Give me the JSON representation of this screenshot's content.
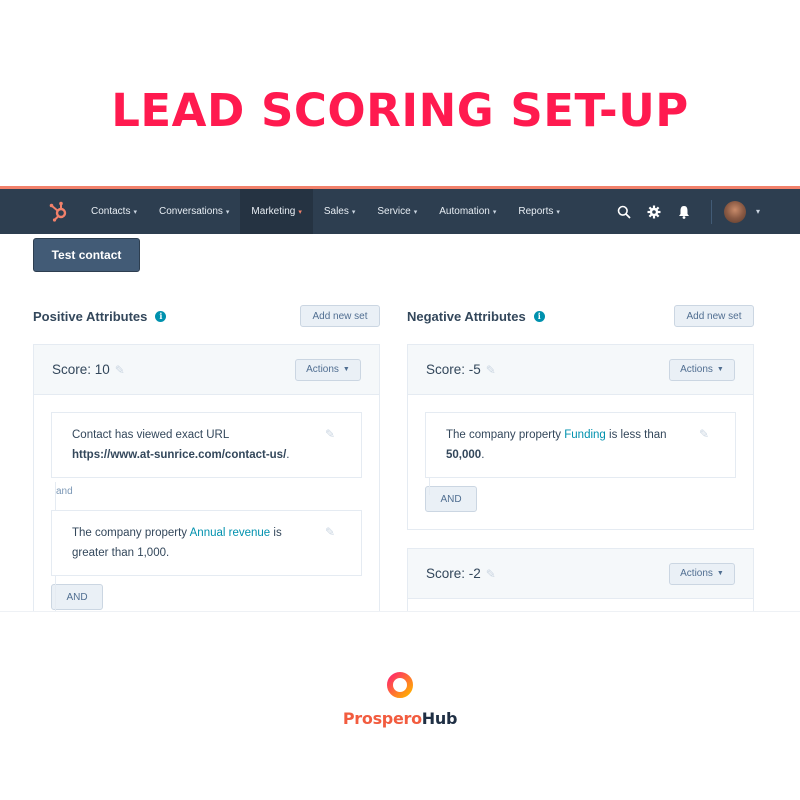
{
  "headline": "LEAD SCORING SET-UP",
  "nav": {
    "items": [
      {
        "label": "Contacts",
        "active": false
      },
      {
        "label": "Conversations",
        "active": false
      },
      {
        "label": "Marketing",
        "active": true
      },
      {
        "label": "Sales",
        "active": false
      },
      {
        "label": "Service",
        "active": false
      },
      {
        "label": "Automation",
        "active": false
      },
      {
        "label": "Reports",
        "active": false
      }
    ],
    "chevron": "⌄",
    "icons": [
      "search-icon",
      "gear-icon",
      "bell-icon"
    ],
    "accent": "#f2816b",
    "background": "#2d3e50"
  },
  "test_contact_label": "Test contact",
  "positive": {
    "title": "Positive Attributes",
    "add_label": "Add new set",
    "sets": [
      {
        "score_label": "Score: 10",
        "actions_label": "Actions",
        "rules": [
          {
            "prefix": "Contact has viewed exact URL ",
            "bold": "https://www.at-sunrice.com/contact-us/",
            "suffix": "."
          },
          {
            "prefix": "The company property ",
            "link": "Annual revenue",
            "suffix": " is greater than 1,000."
          }
        ],
        "joiner": "and",
        "and_label": "AND"
      }
    ]
  },
  "negative": {
    "title": "Negative Attributes",
    "add_label": "Add new set",
    "sets": [
      {
        "score_label": "Score: -5",
        "actions_label": "Actions",
        "rules": [
          {
            "prefix": "The company property ",
            "link": "Funding",
            "suffix": " is less than ",
            "bold": "50,000",
            "end": "."
          }
        ],
        "and_label": "AND"
      },
      {
        "score_label": "Score: -2",
        "actions_label": "Actions"
      }
    ]
  },
  "brand": {
    "part1": "Prospero",
    "part2": "Hub"
  }
}
